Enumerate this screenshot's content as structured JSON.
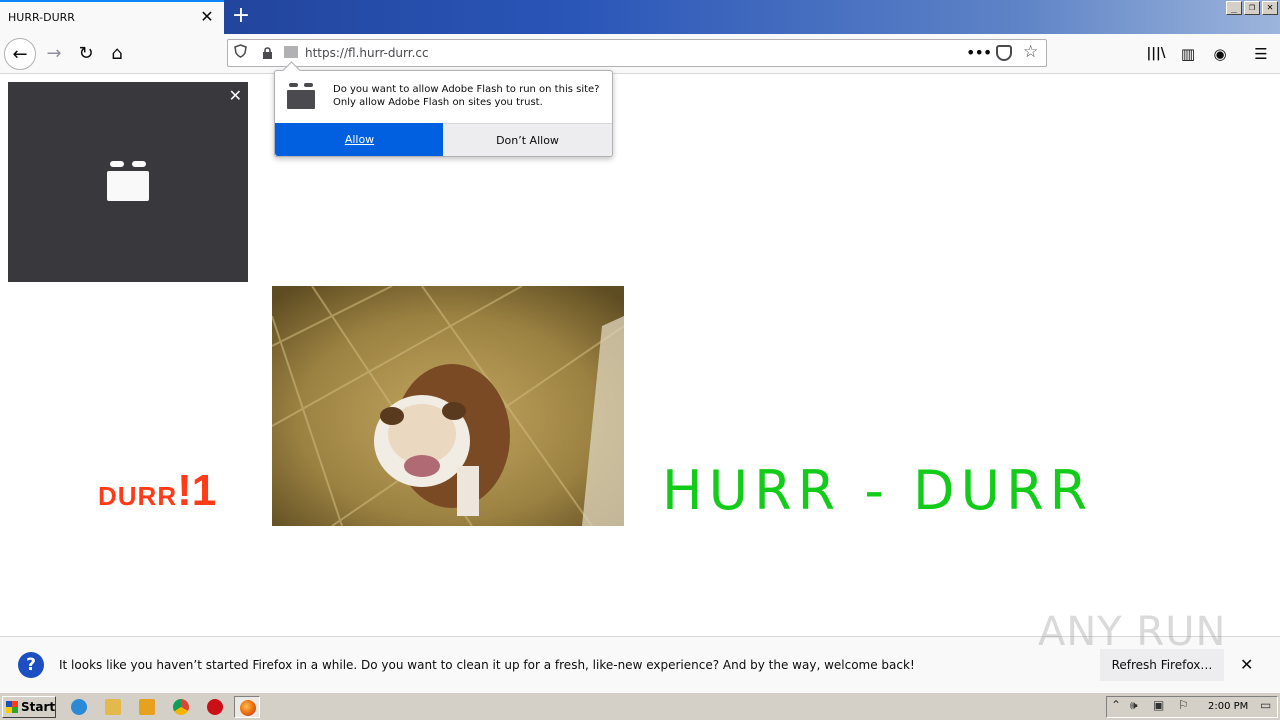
{
  "window": {
    "tab_title": "HURR-DURR",
    "tab_close": "✕",
    "new_tab": "+",
    "controls": {
      "minimize": "_",
      "restore": "❐",
      "close": "✕"
    }
  },
  "nav": {
    "back": "←",
    "forward": "→",
    "reload": "↻",
    "home": "⌂",
    "url": "https://fl.hurr-durr.cc",
    "more": "•••",
    "star": "☆"
  },
  "toolbar": {
    "library": "|||\\",
    "sidebar": "▥",
    "account": "◉",
    "menu": "☰"
  },
  "flash_plugin": {
    "close": "✕"
  },
  "flash_prompt": {
    "message": "Do you want to allow Adobe Flash to run on this site? Only allow Adobe Flash on sites you trust.",
    "allow_label": "Allow",
    "deny_label": "Don’t Allow"
  },
  "page": {
    "durr_small": "DURR",
    "durr_big": "!1",
    "hurr_durr": "HURR - DURR"
  },
  "notification": {
    "icon": "?",
    "message": "It looks like you haven’t started Firefox in a while. Do you want to clean it up for a fresh, like-new experience? And by the way, welcome back!",
    "button_label": "Refresh Firefox…",
    "close": "✕"
  },
  "watermark": "ANY RUN",
  "taskbar": {
    "start_label": "Start",
    "clock": "2:00 PM",
    "apps": [
      "internet-explorer",
      "file-explorer",
      "media-player",
      "chrome",
      "opera",
      "firefox"
    ]
  },
  "colors": {
    "accent_blue": "#0060df",
    "durr_red": "#ff3b1a",
    "hurr_green": "#13cc1a",
    "plugin_bg": "#38383d"
  }
}
